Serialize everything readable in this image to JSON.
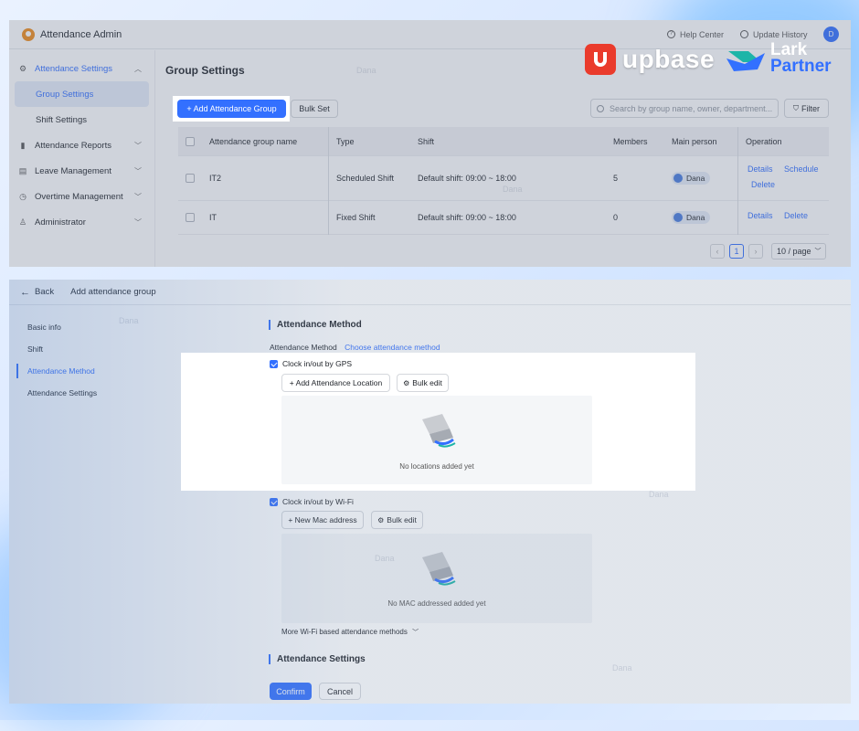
{
  "top": {
    "app_title": "Attendance Admin",
    "help_center": "Help Center",
    "update_history": "Update History",
    "avatar_initial": "D",
    "sidebar": [
      {
        "label": "Attendance Settings",
        "icon": "gear-icon"
      },
      {
        "label": "Group Settings"
      },
      {
        "label": "Shift Settings"
      },
      {
        "label": "Attendance Reports",
        "icon": "bar-chart-icon"
      },
      {
        "label": "Leave Management",
        "icon": "calendar-icon"
      },
      {
        "label": "Overtime Management",
        "icon": "clock-icon"
      },
      {
        "label": "Administrator",
        "icon": "user-icon"
      }
    ],
    "page_title": "Group Settings",
    "add_group_btn": "+ Add Attendance Group",
    "bulk_set_btn": "Bulk Set",
    "search_placeholder": "Search by group name, owner, department...",
    "filter_btn": "Filter",
    "columns": [
      "Attendance group name",
      "Type",
      "Shift",
      "Members",
      "Main person",
      "Operation"
    ],
    "rows": [
      {
        "name": "IT2",
        "type": "Scheduled Shift",
        "shift": "Default shift: 09:00 ~ 18:00",
        "members": "5",
        "person": "Dana",
        "ops": [
          "Details",
          "Schedule",
          "Delete"
        ]
      },
      {
        "name": "IT",
        "type": "Fixed Shift",
        "shift": "Default shift: 09:00 ~ 18:00",
        "members": "0",
        "person": "Dana",
        "ops": [
          "Details",
          "Delete"
        ]
      }
    ],
    "pagination": {
      "page": "1",
      "per_page": "10 / page"
    }
  },
  "brand": {
    "upbase": "upbase",
    "lark": "Lark",
    "partner": "Partner",
    "colors": {
      "upbase": "#ea3b2c",
      "lark_blue": "#3370ff",
      "lark_teal": "#1db5a8"
    }
  },
  "bottom": {
    "back": "Back",
    "title": "Add attendance group",
    "steps": [
      "Basic info",
      "Shift",
      "Attendance Method",
      "Attendance Settings"
    ],
    "section_method": "Attendance Method",
    "method_label": "Attendance Method",
    "choose_method": "Choose attendance method",
    "gps_label": "Clock in/out by GPS",
    "add_location_btn": "+ Add Attendance Location",
    "bulk_edit": "Bulk edit",
    "no_locations": "No locations added yet",
    "wifi_label": "Clock in/out by Wi-Fi",
    "new_mac_btn": "+ New Mac address",
    "bulk_edit2": "Bulk edit",
    "no_mac": "No MAC addressed added yet",
    "more_wifi": "More Wi-Fi based attendance methods",
    "section_settings": "Attendance Settings",
    "confirm": "Confirm",
    "cancel": "Cancel"
  },
  "watermark": "Dana"
}
